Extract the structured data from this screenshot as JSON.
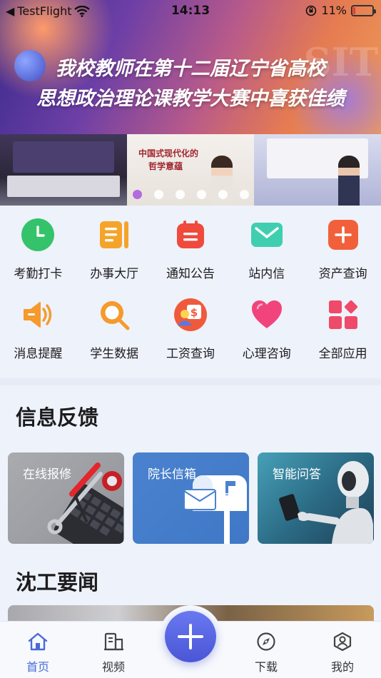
{
  "status_bar": {
    "back_app": "TestFlight",
    "time": "14:13",
    "battery_percent": "11%",
    "battery_level": 0.11,
    "battery_color": "#e53935"
  },
  "banner": {
    "title_line1": "我校教师在第十二届辽宁省高校",
    "title_line2": "思想政治理论课教学大赛中喜获佳绩",
    "photo_caption_line1": "中国式现代化的",
    "photo_caption_line2": "哲学意蕴",
    "slide_count": 6,
    "active_slide": 0
  },
  "functions": [
    {
      "label": "考勤打卡",
      "icon": "clock-icon",
      "color": "#34c36b"
    },
    {
      "label": "办事大厅",
      "icon": "document-list-icon",
      "color": "#f5a42a"
    },
    {
      "label": "通知公告",
      "icon": "calendar-icon",
      "color": "#ef4a3c"
    },
    {
      "label": "站内信",
      "icon": "envelope-icon",
      "color": "#3fcfb0"
    },
    {
      "label": "资产查询",
      "icon": "plus-square-icon",
      "color": "#f2603b"
    },
    {
      "label": "消息提醒",
      "icon": "speaker-icon",
      "color": "#f59a2c"
    },
    {
      "label": "学生数据",
      "icon": "magnifier-icon",
      "color": "#f59a2c"
    },
    {
      "label": "工资查询",
      "icon": "salary-icon",
      "color": "#ef5a3c"
    },
    {
      "label": "心理咨询",
      "icon": "heart-icon",
      "color": "#f2447c"
    },
    {
      "label": "全部应用",
      "icon": "apps-grid-icon",
      "color": "#ef4a6a"
    }
  ],
  "feedback": {
    "title": "信息反馈",
    "cards": [
      {
        "label": "在线报修"
      },
      {
        "label": "院长信箱"
      },
      {
        "label": "智能问答"
      }
    ]
  },
  "news": {
    "title": "沈工要闻"
  },
  "tabbar": {
    "tabs": [
      {
        "label": "首页",
        "icon": "home-icon",
        "active": true
      },
      {
        "label": "视频",
        "icon": "video-building-icon",
        "active": false
      },
      {
        "label": "下载",
        "icon": "compass-icon",
        "active": false
      },
      {
        "label": "我的",
        "icon": "profile-icon",
        "active": false
      }
    ],
    "accent": "#4a6ad8"
  }
}
